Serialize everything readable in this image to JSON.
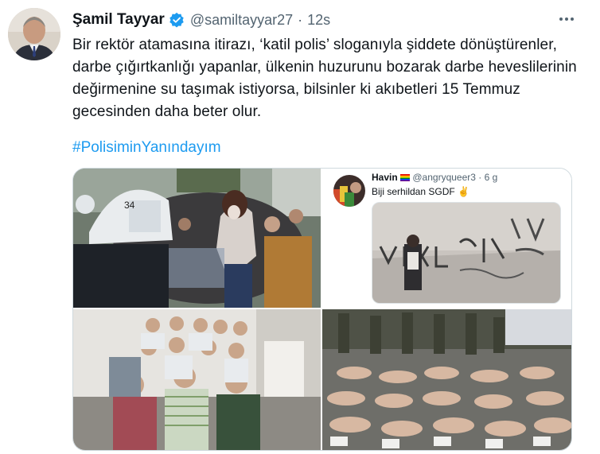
{
  "tweet": {
    "author_name": "Şamil Tayyar",
    "handle": "@samiltayyar27",
    "separator": "·",
    "time": "12s",
    "text": "Bir rektör atamasına itirazı, ‘katil polis’ sloganıyla şiddete dönüştürenler, darbe çığırtkanlığı yapanlar, ülkenin huzurunu bozarak darbe heveslilerinin değirmenine su taşımak istiyorsa, bilsinler ki akıbetleri 15 Temmuz gecesinden daha beter olur.",
    "hashtag": "#PolisiminYanındayım",
    "more_icon": "more-horizontal-icon",
    "verified_icon": "verified-badge-icon"
  },
  "media": {
    "embedded_tweet": {
      "name": "Havin",
      "handle": "@angryqueer3",
      "separator": "·",
      "time": "6 g",
      "text": "Biji serhildan SGDF",
      "emoji": "✌"
    }
  },
  "colors": {
    "accent": "#1d9bf0",
    "verified": "#1d9bf0",
    "secondary_text": "#536471",
    "border": "#cfd9de"
  }
}
